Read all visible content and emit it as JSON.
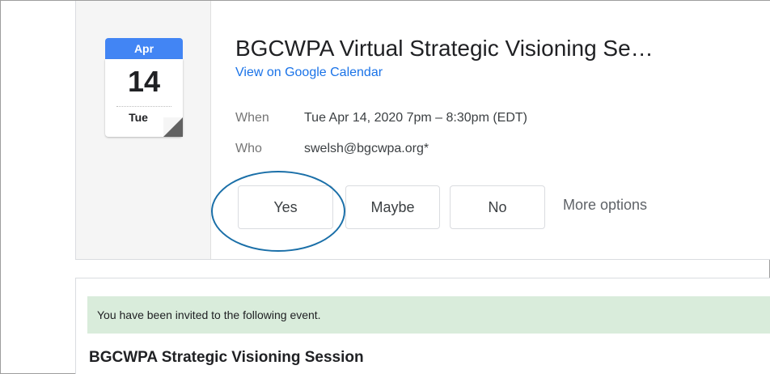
{
  "calendar_icon": {
    "month": "Apr",
    "day": "14",
    "weekday": "Tue"
  },
  "event": {
    "title": "BGCWPA Virtual Strategic Visioning Se…",
    "link_label": "View on Google Calendar",
    "when_label": "When",
    "when_value": "Tue Apr 14, 2020 7pm – 8:30pm (EDT)",
    "who_label": "Who",
    "who_value": "swelsh@bgcwpa.org*"
  },
  "rsvp": {
    "yes": "Yes",
    "maybe": "Maybe",
    "no": "No",
    "more": "More options"
  },
  "invitation": {
    "banner": "You have been invited to the following event.",
    "event_name": "BGCWPA Strategic Visioning Session"
  },
  "colors": {
    "month_header": "#4285f4",
    "link": "#1a73e8",
    "highlight_circle": "#1a6fa8",
    "banner_bg": "#d9ecdb"
  }
}
